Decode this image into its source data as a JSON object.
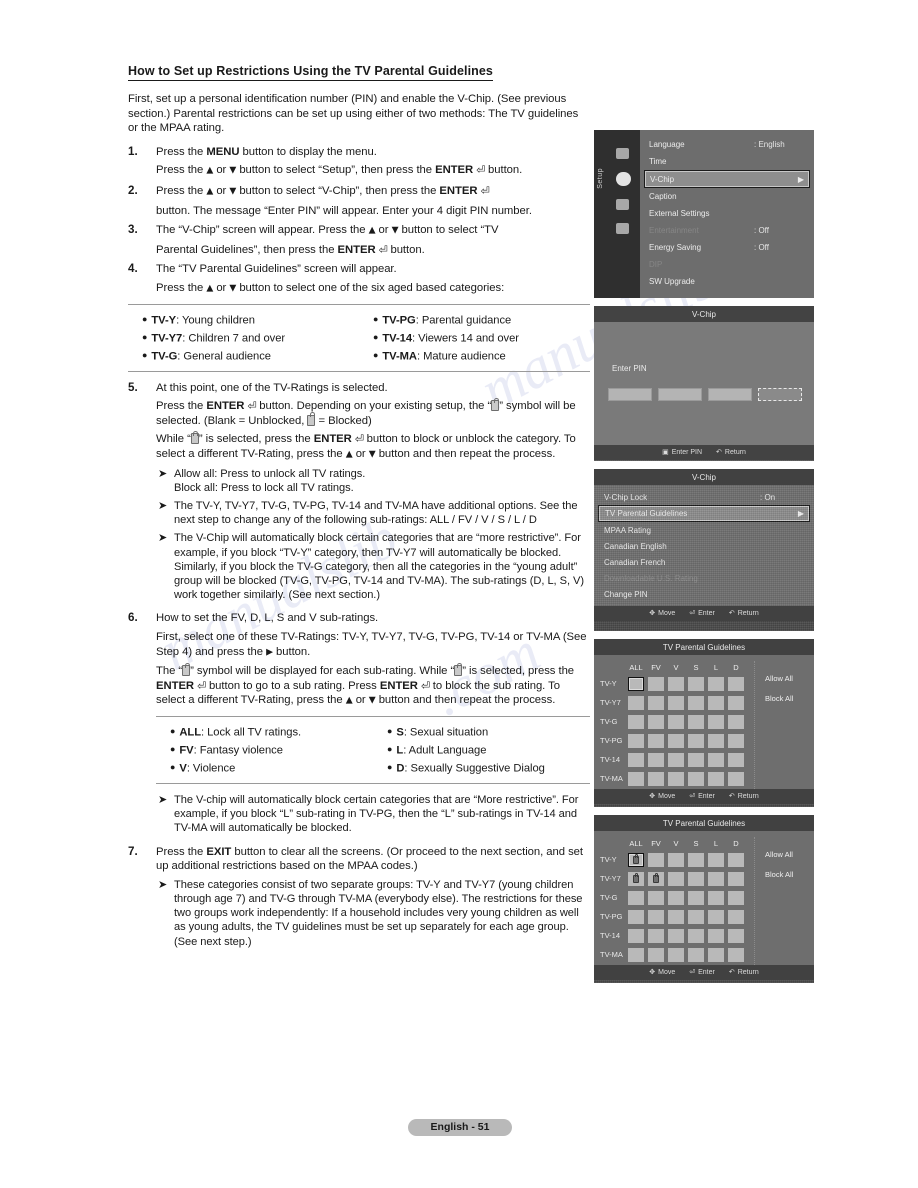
{
  "document": {
    "section_title": "How to Set up Restrictions Using the TV Parental Guidelines",
    "intro": "First, set up a personal identification number (PIN) and enable the V-Chip. (See previous section.) Parental restrictions can be set up using either of two methods: The TV guidelines or the MPAA rating.",
    "footer_page": "English - 51"
  },
  "steps": {
    "s1": {
      "num": "1.",
      "l1_a": "Press the ",
      "l1_b": "MENU",
      "l1_c": " button to display the menu.",
      "l2_a": "Press the ",
      "l2_b": " or ",
      "l2_c": " button to select “Setup”, then press the ",
      "l2_d": "ENTER",
      "l2_e": " button."
    },
    "s2": {
      "num": "2.",
      "l1_a": "Press the ",
      "l1_b": " or ",
      "l1_c": " button to select “V-Chip”, then press the ",
      "l1_d": "ENTER",
      "l2": "button. The message “Enter PIN” will appear. Enter your 4 digit PIN number."
    },
    "s3": {
      "num": "3.",
      "l1_a": "The “V-Chip” screen will appear. Press the ",
      "l1_b": " or ",
      "l1_c": " button to select “TV",
      "l2_a": "Parental Guidelines”, then press the ",
      "l2_b": "ENTER",
      "l2_c": " button."
    },
    "s4": {
      "num": "4.",
      "l1": "The “TV Parental Guidelines” screen will appear.",
      "l2_a": "Press the ",
      "l2_b": " or ",
      "l2_c": " button to select one of the six aged based categories:"
    },
    "s5": {
      "num": "5.",
      "l1": "At this point, one of the TV-Ratings is selected.",
      "l2_a": "Press the ",
      "l2_b": "ENTER",
      "l2_c": " button. Depending on your existing setup, the “",
      "l2_d": "”",
      "l2_e": "symbol will be selected. (Blank = Unblocked, ",
      "l2_f": " = Blocked)",
      "l3_a": "While “",
      "l3_b": "” is selected, press the ",
      "l3_c": "ENTER",
      "l3_d": " button to block or unblock the category. To select a different TV-Rating, press the ",
      "l3_e": " or ",
      "l3_f": " button and then repeat the process."
    },
    "s6": {
      "num": "6.",
      "l1": "How to set the FV, D, L, S and V sub-ratings.",
      "l2_a": "First, select one of these TV-Ratings: TV-Y, TV-Y7, TV-G, TV-PG, TV-14 or TV-MA (See Step 4) and press the ",
      "l2_b": " button.",
      "l3_a": "The “",
      "l3_b": "” symbol will be displayed for each sub-rating. While “",
      "l3_c": "” is selected, press the ",
      "l3_d": "ENTER",
      "l3_e": " button to go to a sub rating. Press ",
      "l3_f": "ENTER",
      "l3_g": " to block the sub rating. To select a different TV-Rating, press the ",
      "l3_h": " or ",
      "l3_i": " button and then repeat the process."
    },
    "s7": {
      "num": "7.",
      "l1_a": "Press the ",
      "l1_b": "EXIT",
      "l1_c": " button to clear all the screens. (Or proceed to the next section, and set up additional restrictions based on the MPAA codes.)"
    }
  },
  "notes": {
    "n1_line1": "Allow all: Press to unlock all TV ratings.",
    "n1_line2": "Block all: Press to lock all TV ratings.",
    "n2": "The TV-Y, TV-Y7, TV-G, TV-PG, TV-14 and TV-MA have additional options. See the next step to change any of the following sub-ratings: ALL / FV / V / S / L / D",
    "n3": "The V-Chip will automatically block certain categories that are “more restrictive”. For example, if you block “TV-Y” category, then TV-Y7 will automatically be blocked. Similarly, if you block the TV-G category, then all the categories in the “young adult” group will be blocked (TV-G, TV-PG, TV-14 and TV-MA). The sub-ratings (D, L, S, V) work together similarly. (See next section.)",
    "n4": "The V-chip will automatically block certain categories that are “More restrictive”. For example, if you block “L” sub-rating in TV-PG, then the “L” sub-ratings in TV-14 and TV-MA will automatically be blocked.",
    "n5": "These categories consist of two separate groups: TV-Y and TV-Y7 (young children through age 7) and TV-G through TV-MA (everybody else). The restrictions for these two groups work independently: If a household includes very young children as well as young adults, the TV guidelines must be set up separately for each age group. (See next step.)"
  },
  "rating_table": {
    "left": [
      {
        "code": "TV-Y",
        "desc": ": Young children"
      },
      {
        "code": "TV-Y7",
        "desc": ": Children 7 and over"
      },
      {
        "code": "TV-G",
        "desc": ": General audience"
      }
    ],
    "right": [
      {
        "code": "TV-PG",
        "desc": ": Parental guidance"
      },
      {
        "code": "TV-14",
        "desc": ": Viewers 14 and over"
      },
      {
        "code": "TV-MA",
        "desc": ": Mature audience"
      }
    ]
  },
  "subrating_table": {
    "left": [
      {
        "code": "ALL",
        "desc": ": Lock all TV ratings."
      },
      {
        "code": "FV",
        "desc": ": Fantasy violence"
      },
      {
        "code": "V",
        "desc": ": Violence"
      }
    ],
    "right": [
      {
        "code": "S",
        "desc": ": Sexual situation"
      },
      {
        "code": "L",
        "desc": ": Adult Language"
      },
      {
        "code": "D",
        "desc": ": Sexually Suggestive Dialog"
      }
    ]
  },
  "screens": {
    "setup_menu": {
      "side_label": "Setup",
      "rows": [
        {
          "name": "Language",
          "value": ": English",
          "state": "normal"
        },
        {
          "name": "Time",
          "value": "",
          "state": "normal"
        },
        {
          "name": "V-Chip",
          "value": "",
          "state": "highlight"
        },
        {
          "name": "Caption",
          "value": "",
          "state": "normal"
        },
        {
          "name": "External Settings",
          "value": "",
          "state": "normal"
        },
        {
          "name": "Entertainment",
          "value": ": Off",
          "state": "dim"
        },
        {
          "name": "Energy Saving",
          "value": ": Off",
          "state": "normal"
        },
        {
          "name": "DIP",
          "value": "",
          "state": "dim"
        },
        {
          "name": "SW Upgrade",
          "value": "",
          "state": "normal"
        }
      ]
    },
    "enter_pin": {
      "title": "V-Chip",
      "label": "Enter PIN",
      "digits": [
        "",
        "",
        "",
        ""
      ],
      "foot": [
        {
          "key": "0~9",
          "label": "Enter PIN"
        },
        {
          "key": "return",
          "label": "Return"
        }
      ]
    },
    "vchip_menu": {
      "title": "V-Chip",
      "rows": [
        {
          "name": "V-Chip Lock",
          "value": ": On",
          "state": "normal"
        },
        {
          "name": "TV Parental Guidelines",
          "value": "",
          "state": "highlight"
        },
        {
          "name": "MPAA Rating",
          "value": "",
          "state": "normal"
        },
        {
          "name": "Canadian English",
          "value": "",
          "state": "normal"
        },
        {
          "name": "Canadian French",
          "value": "",
          "state": "normal"
        },
        {
          "name": "Downloadable U.S. Rating",
          "value": "",
          "state": "dim"
        },
        {
          "name": "Change PIN",
          "value": "",
          "state": "normal"
        }
      ],
      "foot": [
        {
          "key": "move",
          "label": "Move"
        },
        {
          "key": "enter",
          "label": "Enter"
        },
        {
          "key": "return",
          "label": "Return"
        }
      ]
    },
    "guidelines_empty": {
      "title": "TV Parental Guidelines",
      "columns": [
        "ALL",
        "FV",
        "V",
        "S",
        "L",
        "D"
      ],
      "rows": [
        "TV-Y",
        "TV-Y7",
        "TV-G",
        "TV-PG",
        "TV-14",
        "TV-MA"
      ],
      "cells": [
        [
          "sel",
          "off",
          "off",
          "off",
          "off",
          "off"
        ],
        [
          "off",
          "off",
          "off",
          "off",
          "off",
          "off"
        ],
        [
          "off",
          "off",
          "off",
          "off",
          "off",
          "off"
        ],
        [
          "off",
          "off",
          "off",
          "off",
          "off",
          "off"
        ],
        [
          "off",
          "off",
          "off",
          "off",
          "off",
          "off"
        ],
        [
          "off",
          "off",
          "off",
          "off",
          "off",
          "off"
        ]
      ],
      "allow_all": "Allow All",
      "block_all": "Block All",
      "foot": [
        {
          "key": "move",
          "label": "Move"
        },
        {
          "key": "enter",
          "label": "Enter"
        },
        {
          "key": "return",
          "label": "Return"
        }
      ]
    },
    "guidelines_locked": {
      "title": "TV Parental Guidelines",
      "columns": [
        "ALL",
        "FV",
        "V",
        "S",
        "L",
        "D"
      ],
      "rows": [
        "TV-Y",
        "TV-Y7",
        "TV-G",
        "TV-PG",
        "TV-14",
        "TV-MA"
      ],
      "cells": [
        [
          "sel-lock",
          "off",
          "off",
          "off",
          "off",
          "off"
        ],
        [
          "lock",
          "lock",
          "off",
          "off",
          "off",
          "off"
        ],
        [
          "off",
          "off",
          "off",
          "off",
          "off",
          "off"
        ],
        [
          "off",
          "off",
          "off",
          "off",
          "off",
          "off"
        ],
        [
          "off",
          "off",
          "off",
          "off",
          "off",
          "off"
        ],
        [
          "off",
          "off",
          "off",
          "off",
          "off",
          "off"
        ]
      ],
      "allow_all": "Allow All",
      "block_all": "Block All",
      "foot": [
        {
          "key": "move",
          "label": "Move"
        },
        {
          "key": "enter",
          "label": "Enter"
        },
        {
          "key": "return",
          "label": "Return"
        }
      ]
    }
  },
  "glyphs": {
    "up": "▲",
    "down": "▼",
    "right": "▶",
    "enter": "↵",
    "return": "↶",
    "move": "✥"
  },
  "watermark": {
    "w1": "manualslib",
    "w2": "manualslib",
    "w3": ".com"
  }
}
